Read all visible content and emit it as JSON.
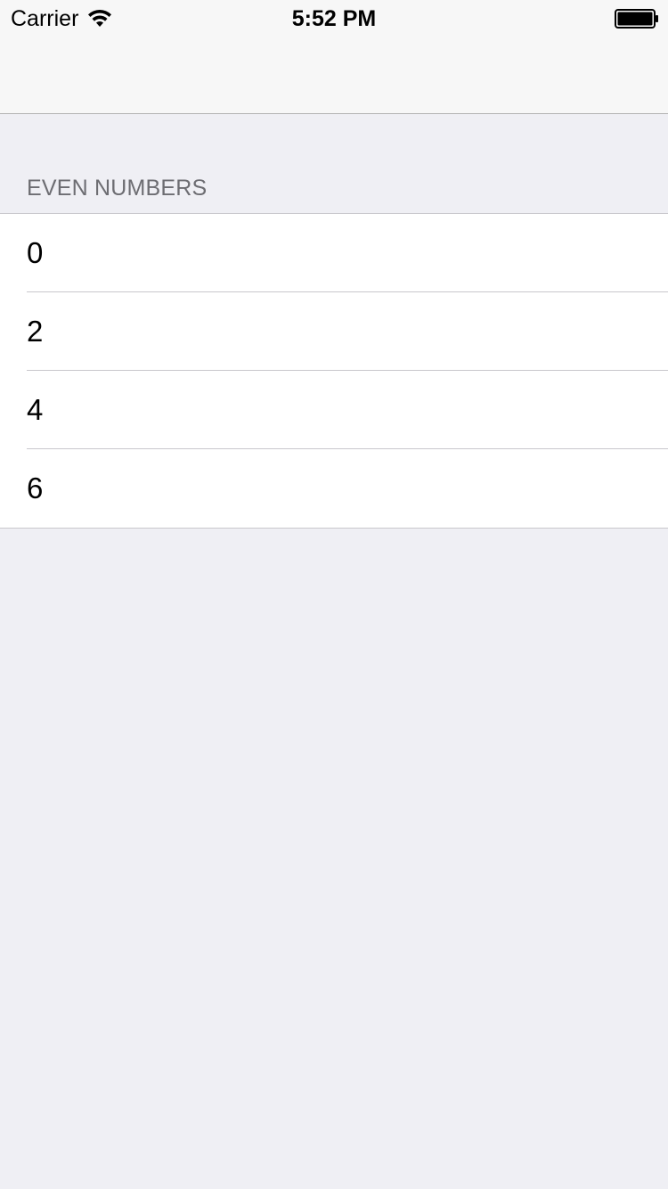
{
  "status_bar": {
    "carrier": "Carrier",
    "time": "5:52 PM",
    "wifi_icon": "wifi-icon",
    "battery_icon": "battery-icon"
  },
  "section": {
    "header": "EVEN NUMBERS",
    "rows": [
      {
        "label": "0"
      },
      {
        "label": "2"
      },
      {
        "label": "4"
      },
      {
        "label": "6"
      }
    ]
  },
  "colors": {
    "background": "#efeff4",
    "nav_bar": "#f7f7f7",
    "section_header_text": "#6d6d72",
    "separator": "#c8c7cc"
  }
}
